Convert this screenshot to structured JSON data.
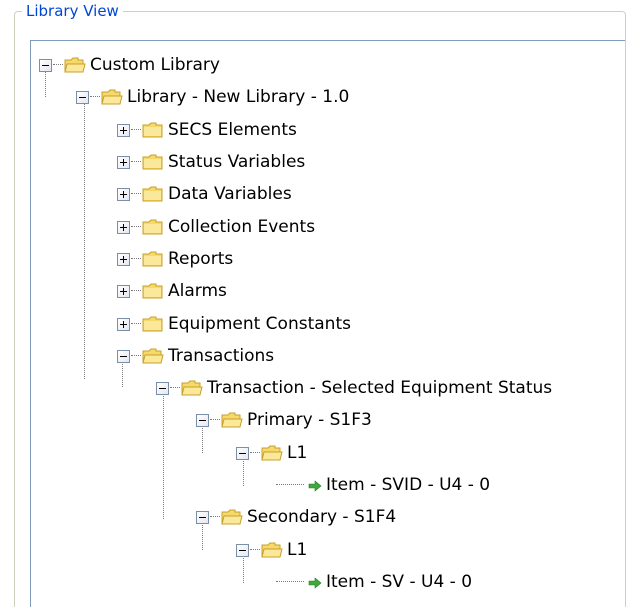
{
  "panel": {
    "title": "Library View"
  },
  "tree": {
    "nodes": [
      {
        "id": "custom-library",
        "label": "Custom Library",
        "expanded": true,
        "icon": "folder-open-icon"
      },
      {
        "id": "library-new",
        "label": "Library - New Library - 1.0",
        "expanded": true,
        "icon": "folder-open-icon"
      },
      {
        "id": "secs-elements",
        "label": "SECS Elements",
        "expanded": false,
        "icon": "folder-closed-icon"
      },
      {
        "id": "status-variables",
        "label": "Status Variables",
        "expanded": false,
        "icon": "folder-closed-icon"
      },
      {
        "id": "data-variables",
        "label": "Data Variables",
        "expanded": false,
        "icon": "folder-closed-icon"
      },
      {
        "id": "collection-events",
        "label": "Collection Events",
        "expanded": false,
        "icon": "folder-closed-icon"
      },
      {
        "id": "reports",
        "label": "Reports",
        "expanded": false,
        "icon": "folder-closed-icon"
      },
      {
        "id": "alarms",
        "label": "Alarms",
        "expanded": false,
        "icon": "folder-closed-icon"
      },
      {
        "id": "equipment-constants",
        "label": "Equipment Constants",
        "expanded": false,
        "icon": "folder-closed-icon"
      },
      {
        "id": "transactions",
        "label": "Transactions",
        "expanded": true,
        "icon": "folder-open-icon"
      },
      {
        "id": "transaction-ses",
        "label": "Transaction - Selected Equipment Status",
        "expanded": true,
        "icon": "folder-open-icon"
      },
      {
        "id": "primary-s1f3",
        "label": "Primary - S1F3",
        "expanded": true,
        "icon": "folder-open-icon"
      },
      {
        "id": "primary-l1",
        "label": "L1",
        "expanded": true,
        "icon": "folder-open-icon"
      },
      {
        "id": "item-svid",
        "label": "Item - SVID - U4 - 0",
        "icon": "arrow-right-icon"
      },
      {
        "id": "secondary-s1f4",
        "label": "Secondary - S1F4",
        "expanded": true,
        "icon": "folder-open-icon"
      },
      {
        "id": "secondary-l1",
        "label": "L1",
        "expanded": true,
        "icon": "folder-open-icon"
      },
      {
        "id": "item-sv",
        "label": "Item - SV - U4 - 0",
        "icon": "arrow-right-icon"
      }
    ]
  },
  "colors": {
    "title": "#0046d5",
    "folder_fill": "#f5d96b",
    "folder_edge": "#c8a028",
    "arrow": "#3fa83a"
  }
}
